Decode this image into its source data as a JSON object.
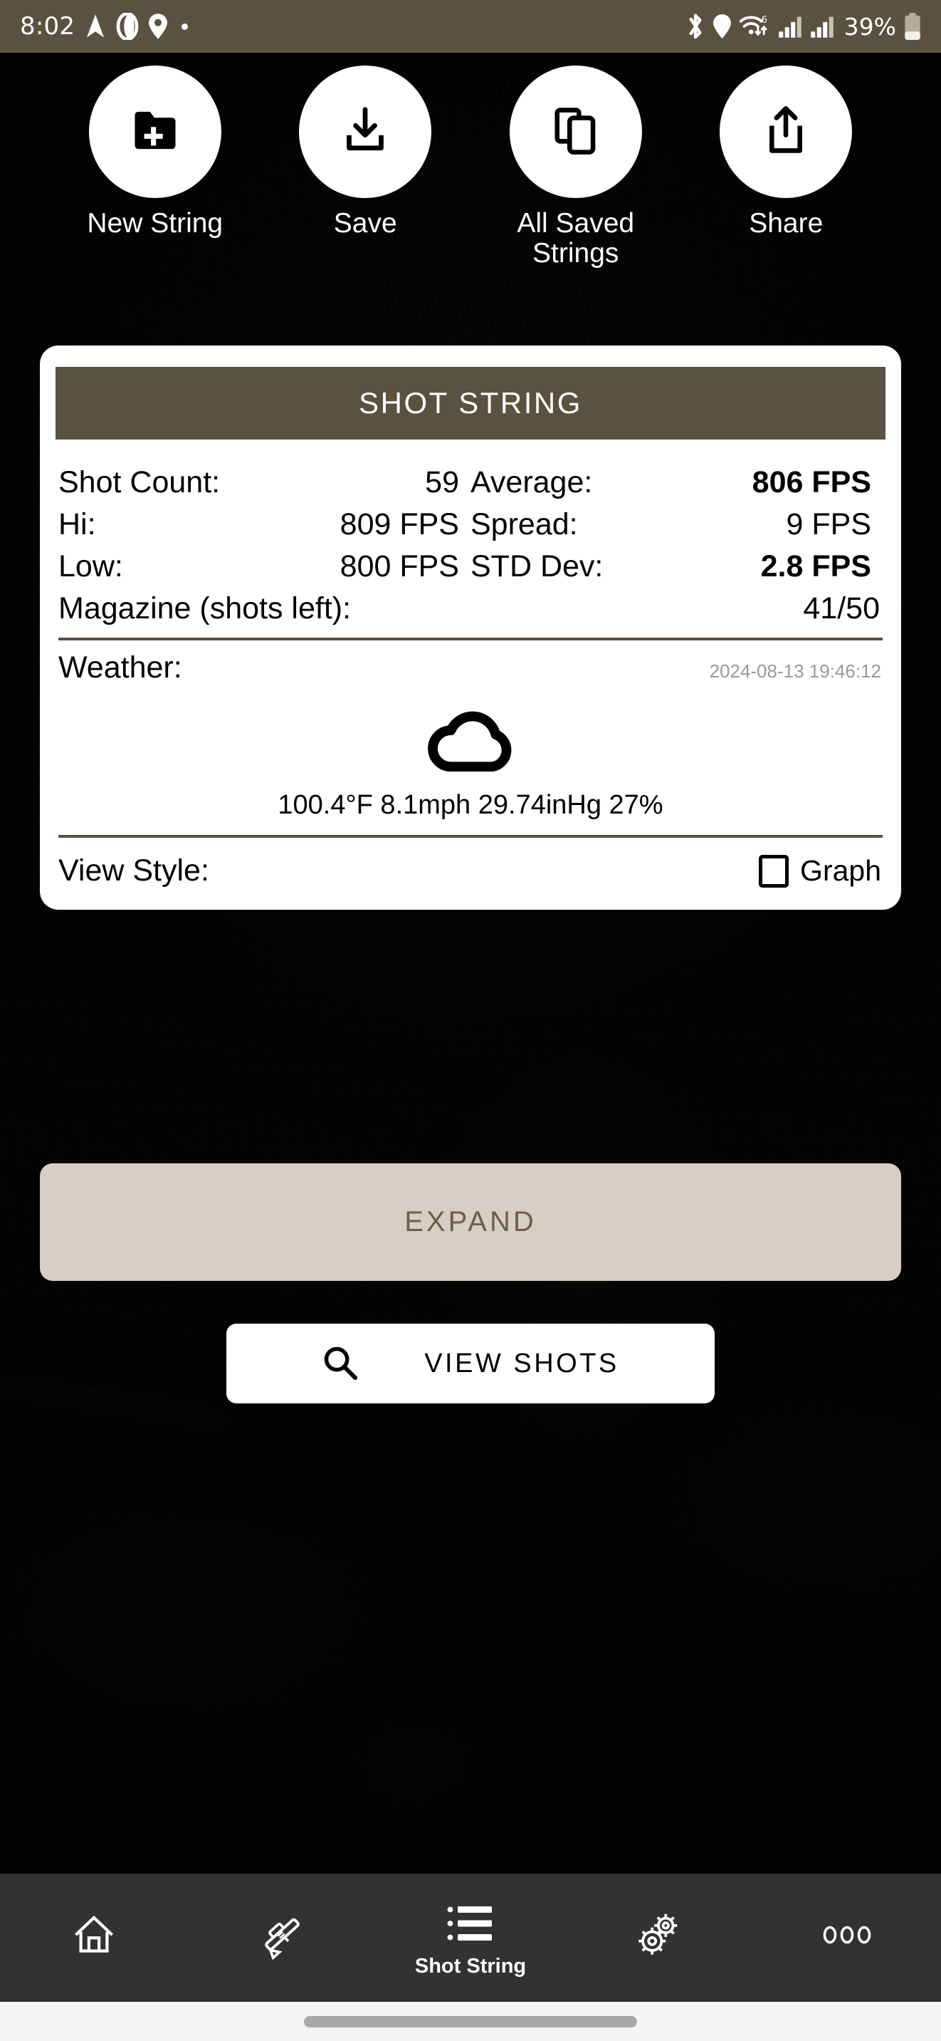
{
  "status_bar": {
    "time": "8:02",
    "battery_percent": "39%",
    "left_icons": [
      "navigation-arrow-icon",
      "opera-o-icon",
      "location-pin-icon",
      "dot-icon"
    ],
    "right_icons": [
      "bluetooth-icon",
      "location-pin-icon",
      "wifi-6-icon",
      "signal-bars-icon",
      "signal-bars-icon",
      "battery-icon"
    ],
    "background_color": "#5b5140"
  },
  "actions": [
    {
      "label": "New String",
      "icon": "new-folder-plus-icon"
    },
    {
      "label": "Save",
      "icon": "download-save-icon"
    },
    {
      "label": "All Saved Strings",
      "icon": "copy-stack-icon"
    },
    {
      "label": "Share",
      "icon": "share-upload-icon"
    }
  ],
  "card": {
    "header_title": "SHOT STRING",
    "header_color": "#5b5140",
    "stats": [
      {
        "label": "Shot Count:",
        "value": "59",
        "bold": false,
        "label2": "Average:",
        "value2": "806 FPS",
        "bold2": true
      },
      {
        "label": "Hi:",
        "value": "809 FPS",
        "bold": false,
        "label2": "Spread:",
        "value2": "9 FPS",
        "bold2": false
      },
      {
        "label": "Low:",
        "value": "800 FPS",
        "bold": false,
        "label2": "STD Dev:",
        "value2": "2.8 FPS",
        "bold2": true
      }
    ],
    "magazine": {
      "label": "Magazine (shots left):",
      "value": "41/50"
    },
    "weather": {
      "label": "Weather:",
      "timestamp": "2024-08-13 19:46:12",
      "icon": "cloud-icon",
      "summary": "100.4°F 8.1mph 29.74inHg 27%",
      "temperature": "100.4°F",
      "wind": "8.1mph",
      "pressure": "29.74inHg",
      "humidity": "27%"
    },
    "view_style": {
      "label": "View Style:",
      "checkbox_label": "Graph",
      "checked": false
    }
  },
  "expand_button": {
    "label": "EXPAND",
    "color": "#d9cec5",
    "text_color": "#6b5f4b"
  },
  "view_shots_button": {
    "label": "VIEW SHOTS",
    "icon": "search-icon"
  },
  "bottom_nav": {
    "items": [
      {
        "label": "",
        "icon": "home-icon",
        "active": false
      },
      {
        "label": "",
        "icon": "rifle-icon",
        "active": false
      },
      {
        "label": "Shot String",
        "icon": "list-icon",
        "active": true
      },
      {
        "label": "",
        "icon": "gears-icon",
        "active": false
      },
      {
        "label": "",
        "icon": "more-dots-icon",
        "active": false
      }
    ]
  }
}
